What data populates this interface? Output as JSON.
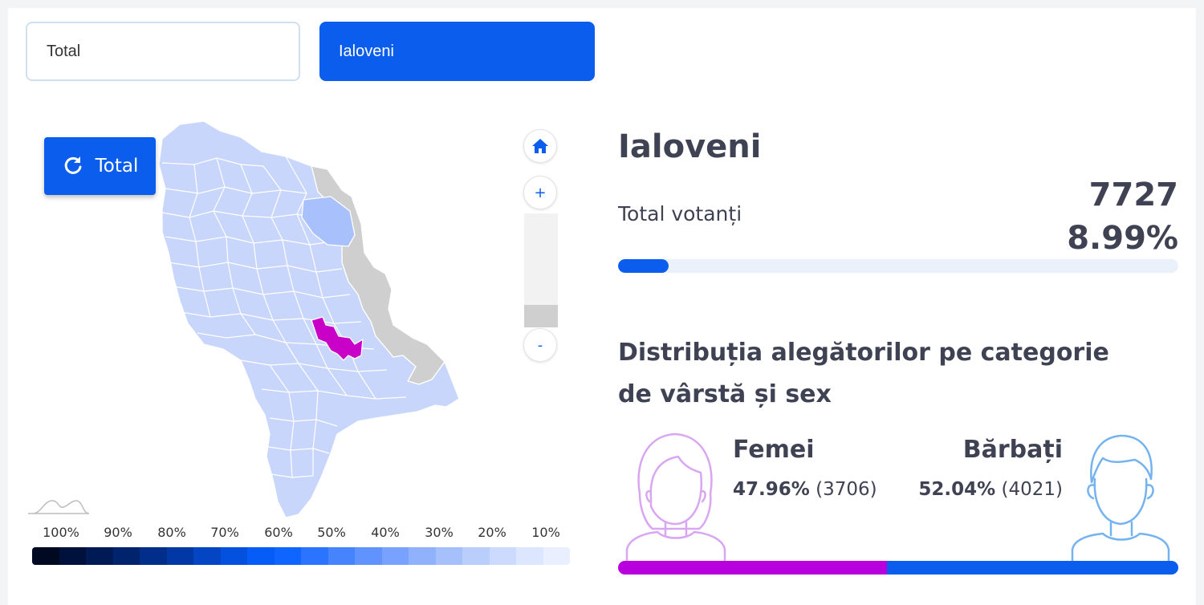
{
  "selectors": {
    "total_label": "Total",
    "region_label": "Ialoveni"
  },
  "map": {
    "reset_button_label": "Total",
    "home_icon": "home-icon",
    "zoom_in_label": "+",
    "zoom_out_label": "-",
    "highlight_color": "#c800c8",
    "base_color": "#c9d6fb",
    "disabled_color": "#cfcfcf",
    "legend": {
      "labels": [
        "100%",
        "90%",
        "80%",
        "70%",
        "60%",
        "50%",
        "40%",
        "30%",
        "20%",
        "10%"
      ],
      "colors": [
        "#000922",
        "#00113b",
        "#001a55",
        "#00236e",
        "#002e8a",
        "#0238a6",
        "#0445c3",
        "#0551df",
        "#065cf6",
        "#0f65ff",
        "#2b74ff",
        "#4684fd",
        "#6093fd",
        "#78a2fd",
        "#90b1fc",
        "#a6c0fc",
        "#bacefc",
        "#ccdafd",
        "#dce6fe",
        "#e9effe"
      ]
    }
  },
  "details": {
    "region_title": "Ialoveni",
    "total_voters_label": "Total votanți",
    "total_voters_count": "7727",
    "total_voters_percent": "8.99%",
    "progress_fraction": 0.0899,
    "distribution_title": "Distribuția alegătorilor pe categorie de vârstă și sex",
    "female": {
      "label": "Femei",
      "percent": "47.96%",
      "count": "(3706)",
      "fraction": 0.4796,
      "color": "#b800de"
    },
    "male": {
      "label": "Bărbați",
      "percent": "52.04%",
      "count": "(4021)",
      "fraction": 0.5204,
      "color": "#0a5ded"
    }
  }
}
